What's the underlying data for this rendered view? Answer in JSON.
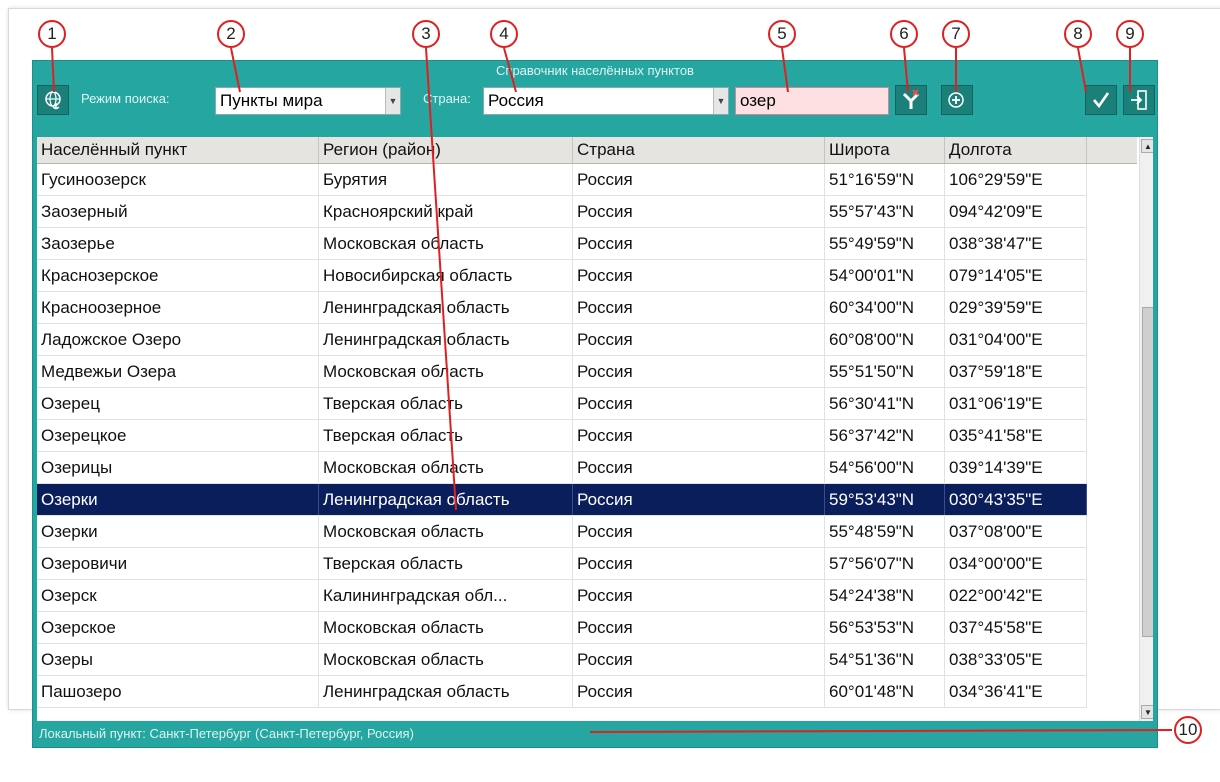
{
  "window": {
    "title": "Справочник населённых пунктов"
  },
  "toolbar": {
    "search_mode_label": "Режим поиска:",
    "search_mode_value": "Пункты мира",
    "country_label": "Страна:",
    "country_value": "Россия",
    "search_text": "озер"
  },
  "icons": {
    "globe": "globe-anchor-icon",
    "filter": "filter-clear-icon",
    "add": "add-location-icon",
    "ok": "checkmark-icon",
    "exit": "exit-icon"
  },
  "callouts": [
    "1",
    "2",
    "3",
    "4",
    "5",
    "6",
    "7",
    "8",
    "9",
    "10"
  ],
  "table": {
    "headers": [
      "Населённый пункт",
      "Регион (район)",
      "Страна",
      "Широта",
      "Долгота"
    ],
    "rows": [
      [
        "Гусиноозерск",
        "Бурятия",
        "Россия",
        "51°16'59\"N",
        "106°29'59\"E"
      ],
      [
        "Заозерный",
        "Красноярский край",
        "Россия",
        "55°57'43\"N",
        "094°42'09\"E"
      ],
      [
        "Заозерье",
        "Московская область",
        "Россия",
        "55°49'59\"N",
        "038°38'47\"E"
      ],
      [
        "Краснозерское",
        "Новосибирская область",
        "Россия",
        "54°00'01\"N",
        "079°14'05\"E"
      ],
      [
        "Красноозерное",
        "Ленинградская область",
        "Россия",
        "60°34'00\"N",
        "029°39'59\"E"
      ],
      [
        "Ладожское Озеро",
        "Ленинградская область",
        "Россия",
        "60°08'00\"N",
        "031°04'00\"E"
      ],
      [
        "Медвежьи Озера",
        "Московская область",
        "Россия",
        "55°51'50\"N",
        "037°59'18\"E"
      ],
      [
        "Озерец",
        "Тверская область",
        "Россия",
        "56°30'41\"N",
        "031°06'19\"E"
      ],
      [
        "Озерецкое",
        "Тверская область",
        "Россия",
        "56°37'42\"N",
        "035°41'58\"E"
      ],
      [
        "Озерицы",
        "Московская область",
        "Россия",
        "54°56'00\"N",
        "039°14'39\"E"
      ],
      [
        "Озерки",
        "Ленинградская область",
        "Россия",
        "59°53'43\"N",
        "030°43'35\"E"
      ],
      [
        "Озерки",
        "Московская область",
        "Россия",
        "55°48'59\"N",
        "037°08'00\"E"
      ],
      [
        "Озеровичи",
        "Тверская область",
        "Россия",
        "57°56'07\"N",
        "034°00'00\"E"
      ],
      [
        "Озерск",
        "Калининградская обл...",
        "Россия",
        "54°24'38\"N",
        "022°00'42\"E"
      ],
      [
        "Озерское",
        "Московская область",
        "Россия",
        "56°53'53\"N",
        "037°45'58\"E"
      ],
      [
        "Озеры",
        "Московская область",
        "Россия",
        "54°51'36\"N",
        "038°33'05\"E"
      ],
      [
        "Пашозеро",
        "Ленинградская область",
        "Россия",
        "60°01'48\"N",
        "034°36'41\"E"
      ]
    ],
    "selected_index": 10
  },
  "status": {
    "text": "Локальный пункт: Санкт-Петербург (Санкт-Петербург, Россия)"
  },
  "colors": {
    "accent": "#25a6a0",
    "selection": "#0b1e5c",
    "search_bg": "#ffe0e2",
    "callout": "#e02020"
  }
}
